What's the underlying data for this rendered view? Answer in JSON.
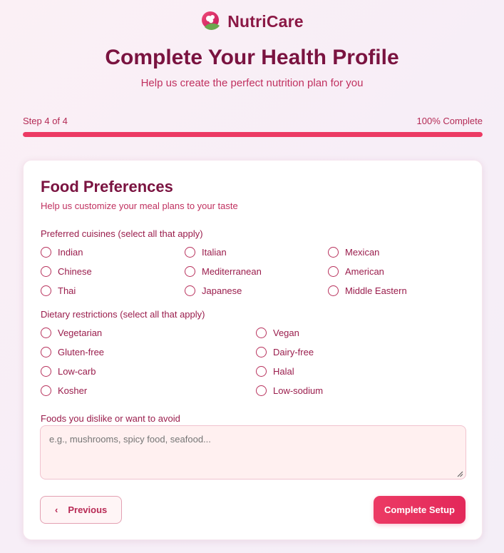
{
  "app": {
    "name": "NutriCare",
    "logo_icon": "apple-leaf-icon"
  },
  "header": {
    "title": "Complete Your Health Profile",
    "subtitle": "Help us create the perfect nutrition plan for you"
  },
  "progress": {
    "step_text": "Step 4 of 4",
    "percent_text": "100% Complete",
    "value": 1.0
  },
  "card": {
    "title": "Food Preferences",
    "subtitle": "Help us customize your meal plans to your taste",
    "cuisines": {
      "label": "Preferred cuisines (select all that apply)",
      "options": [
        "Indian",
        "Italian",
        "Mexican",
        "Chinese",
        "Mediterranean",
        "American",
        "Thai",
        "Japanese",
        "Middle Eastern"
      ]
    },
    "dietary": {
      "label": "Dietary restrictions (select all that apply)",
      "options": [
        "Vegetarian",
        "Vegan",
        "Gluten-free",
        "Dairy-free",
        "Low-carb",
        "Halal",
        "Kosher",
        "Low-sodium"
      ]
    },
    "dislikes": {
      "label": "Foods you dislike or want to avoid",
      "placeholder": "e.g., mushrooms, spicy food, seafood..."
    }
  },
  "actions": {
    "previous_label": "Previous",
    "previous_icon": "chevron-left-icon",
    "complete_label": "Complete Setup"
  },
  "colors": {
    "accent": "#ec3a64",
    "brand_dark": "#7a1340",
    "input_bg": "#fff0f0"
  }
}
